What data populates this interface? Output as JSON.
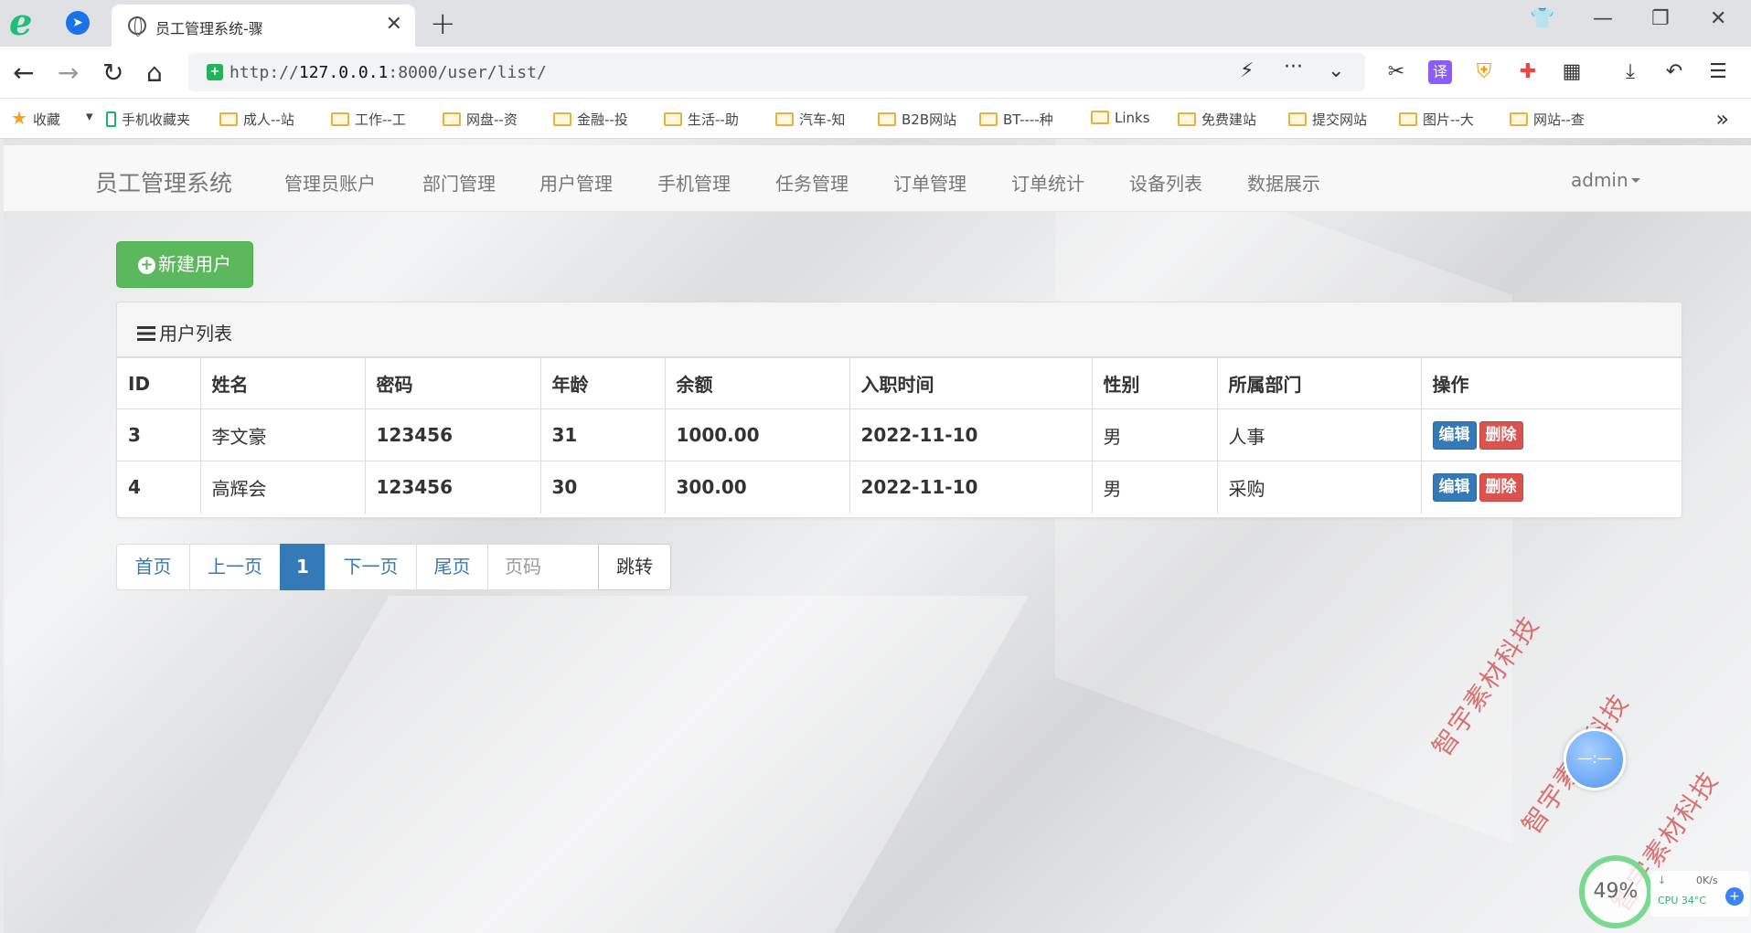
{
  "browser": {
    "tab_title": "员工管理系统-骤",
    "url_prefix": "http://",
    "url_host": "127.0.0.1",
    "url_rest": ":8000/user/list/",
    "bookmarks": [
      "收藏",
      "手机收藏夹",
      "成人--站",
      "工作--工",
      "网盘--资",
      "金融--投",
      "生活--助",
      "汽车-知",
      "B2B网站",
      "BT----种",
      "Links",
      "免费建站",
      "提交网站",
      "图片--大",
      "网站--查"
    ]
  },
  "navbar": {
    "brand": "员工管理系统",
    "links": [
      "管理员账户",
      "部门管理",
      "用户管理",
      "手机管理",
      "任务管理",
      "订单管理",
      "订单统计",
      "设备列表",
      "数据展示"
    ],
    "user": "admin"
  },
  "main": {
    "new_user_button": "新建用户",
    "panel_title": "用户列表",
    "table": {
      "headers": [
        "ID",
        "姓名",
        "密码",
        "年龄",
        "余额",
        "入职时间",
        "性别",
        "所属部门",
        "操作"
      ],
      "rows": [
        [
          "3",
          "李文豪",
          "123456",
          "31",
          "1000.00",
          "2022-11-10",
          "男",
          "人事"
        ],
        [
          "4",
          "高辉会",
          "123456",
          "30",
          "300.00",
          "2022-11-10",
          "男",
          "采购"
        ]
      ],
      "edit_label": "编辑",
      "delete_label": "删除"
    },
    "pagination": {
      "first": "首页",
      "prev": "上一页",
      "current": "1",
      "next": "下一页",
      "last": "尾页",
      "input_placeholder": "页码",
      "jump": "跳转"
    }
  },
  "overlay": {
    "watermark": "智宇素材科技",
    "cpu_percent": "49%",
    "net_speed": "0K/s",
    "cpu_temp": "CPU 34°C"
  }
}
